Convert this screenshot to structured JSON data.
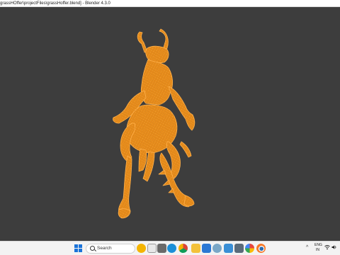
{
  "window": {
    "title": "grassHOffer\\projectFiles\\grassHoffer.blend] - Blender 4.3.0"
  },
  "viewport": {
    "background": "#3d3d3d",
    "wire_color": "#f0941a",
    "object_icon": "grasshopper-wireframe-mesh"
  },
  "taskbar": {
    "search_label": "Search",
    "icons": [
      "windows-start-icon",
      "search-icon",
      "widget-icon",
      "task-view-icon",
      "edge-icon",
      "chrome-icon",
      "file-explorer-icon",
      "store-icon",
      "settings-icon",
      "photos-icon",
      "color-picker-icon",
      "blender-icon"
    ],
    "tray": {
      "chevron": "^",
      "lang_line1": "ENG",
      "lang_line2": "IN"
    }
  }
}
